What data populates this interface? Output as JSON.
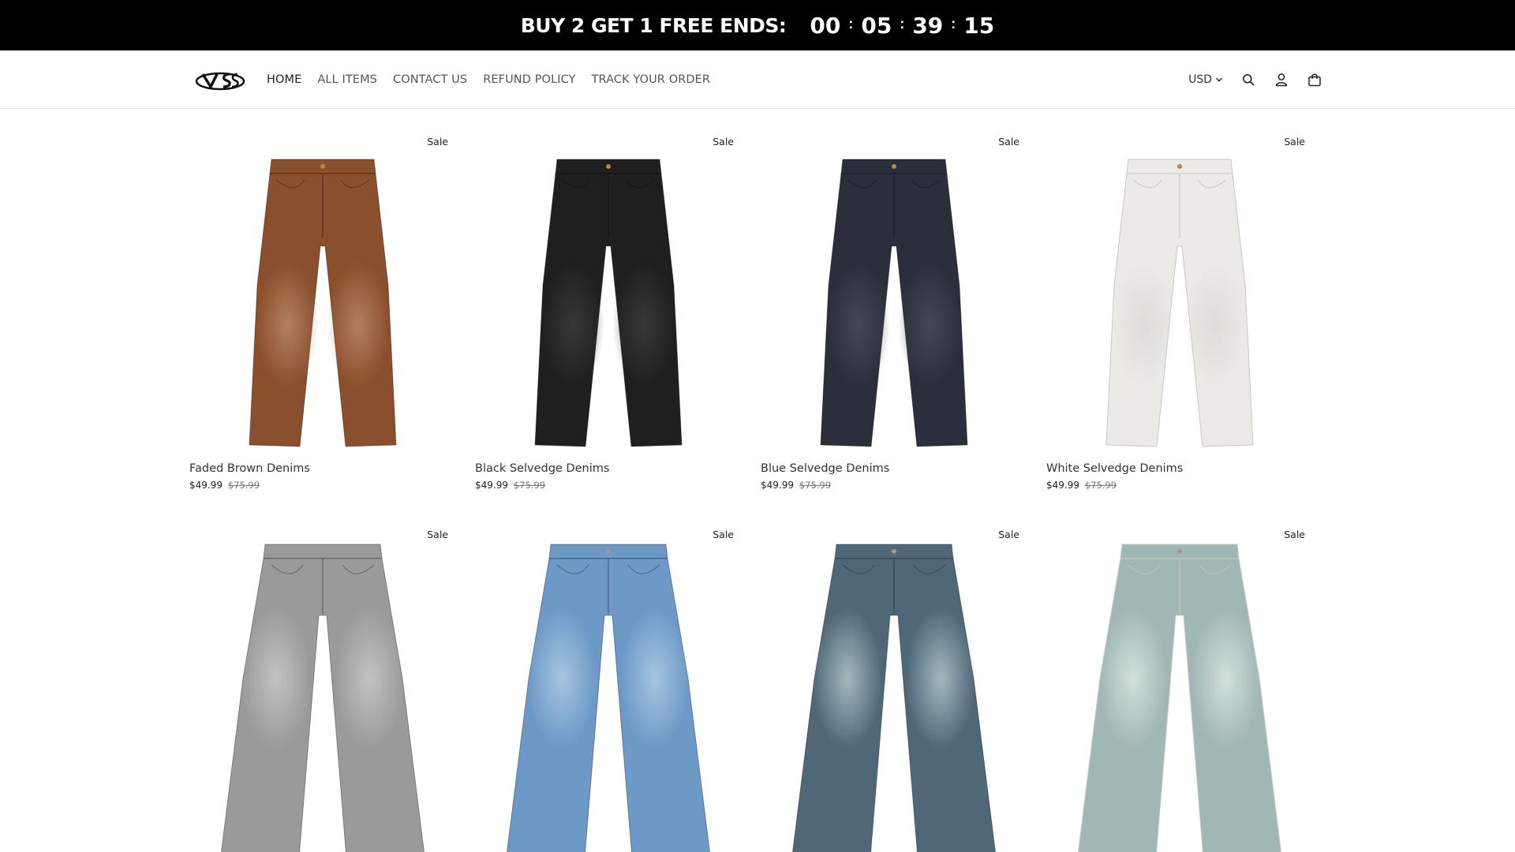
{
  "announcement": {
    "text": "BUY 2 GET 1 FREE ENDS:",
    "timer": [
      "00",
      "05",
      "39",
      "15"
    ]
  },
  "header": {
    "logo": "VS",
    "nav": [
      {
        "label": "HOME",
        "active": true
      },
      {
        "label": "ALL ITEMS",
        "active": false
      },
      {
        "label": "CONTACT US",
        "active": false
      },
      {
        "label": "REFUND POLICY",
        "active": false
      },
      {
        "label": "TRACK YOUR ORDER",
        "active": false
      }
    ],
    "currency": "USD",
    "icons": [
      "search-icon",
      "account-icon",
      "cart-icon"
    ]
  },
  "products": [
    {
      "title": "Faded Brown Denims",
      "badge": "Sale",
      "price": "$49.99",
      "compare_price": "$75.99",
      "color": "#8a4f2c",
      "shade": "#b98466",
      "style": "straight"
    },
    {
      "title": "Black Selvedge Denims",
      "badge": "Sale",
      "price": "$49.99",
      "compare_price": "$75.99",
      "color": "#1f1f1f",
      "shade": "#3a3a3a",
      "style": "straight"
    },
    {
      "title": "Blue Selvedge Denims",
      "badge": "Sale",
      "price": "$49.99",
      "compare_price": "$75.99",
      "color": "#2a2f3b",
      "shade": "#454b57",
      "style": "straight"
    },
    {
      "title": "White Selvedge Denims",
      "badge": "Sale",
      "price": "$49.99",
      "compare_price": "$75.99",
      "color": "#eceae6",
      "shade": "#dcdad5",
      "style": "straight"
    },
    {
      "title": "",
      "badge": "Sale",
      "price": "",
      "compare_price": "",
      "color": "#9a9a98",
      "shade": "#c4c4c2",
      "style": "wide"
    },
    {
      "title": "",
      "badge": "Sale",
      "price": "",
      "compare_price": "",
      "color": "#6c99c6",
      "shade": "#a9c7e2",
      "style": "wide"
    },
    {
      "title": "",
      "badge": "Sale",
      "price": "",
      "compare_price": "",
      "color": "#4e6878",
      "shade": "#a6bdc2",
      "style": "wide"
    },
    {
      "title": "",
      "badge": "Sale",
      "price": "",
      "compare_price": "",
      "color": "#9fb7b5",
      "shade": "#d4e2dc",
      "style": "wide"
    }
  ]
}
